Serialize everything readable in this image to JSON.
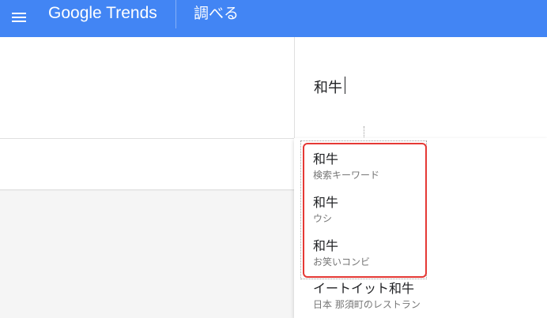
{
  "topbar": {
    "app_name": "Google Trends",
    "page_title": "調べる",
    "color": "#4285f4"
  },
  "search": {
    "query": "和牛"
  },
  "suggestions": [
    {
      "title": "和牛",
      "subtitle": "検索キーワード"
    },
    {
      "title": "和牛",
      "subtitle": "ウシ"
    },
    {
      "title": "和牛",
      "subtitle": "お笑いコンビ"
    },
    {
      "title": "イートイット和牛",
      "subtitle": "日本 那須町のレストラン"
    }
  ],
  "highlight_color": "#e53935"
}
